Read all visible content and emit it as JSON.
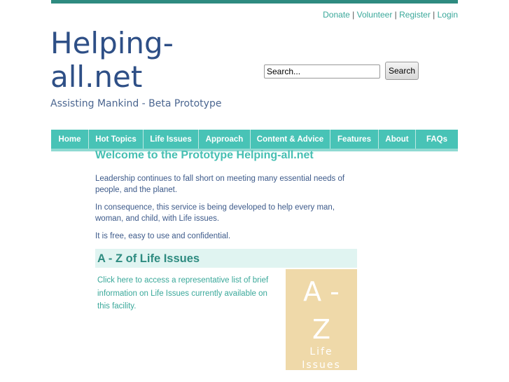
{
  "top_links": [
    "Donate",
    "Volunteer",
    "Register",
    "Login"
  ],
  "site": {
    "title_line1": "Helping-",
    "title_line2": "all.net",
    "tagline": "Assisting Mankind - Beta Prototype"
  },
  "search": {
    "placeholder": "Search...",
    "button": "Search"
  },
  "nav": [
    "Home",
    "Hot Topics",
    "Life Issues",
    "Approach",
    "Content & Advice",
    "Features",
    "About",
    "FAQs"
  ],
  "main": {
    "heading": "Welcome to the Prototype Helping-all.net",
    "paragraphs": [
      "Leadership continues to fall short on meeting many essential needs of people, and the planet.",
      "In consequence, this service is being developed to help every man, woman, and child, with Life issues.",
      "It is free, easy to use and confidential."
    ]
  },
  "az": {
    "heading": "A - Z of Life Issues",
    "link_text": "Click here to access a representative list of brief information on Life Issues currently available on this facility.",
    "box_line1": "A -",
    "box_line2": "Z",
    "box_line3": "Life",
    "box_line4": "Issues"
  }
}
